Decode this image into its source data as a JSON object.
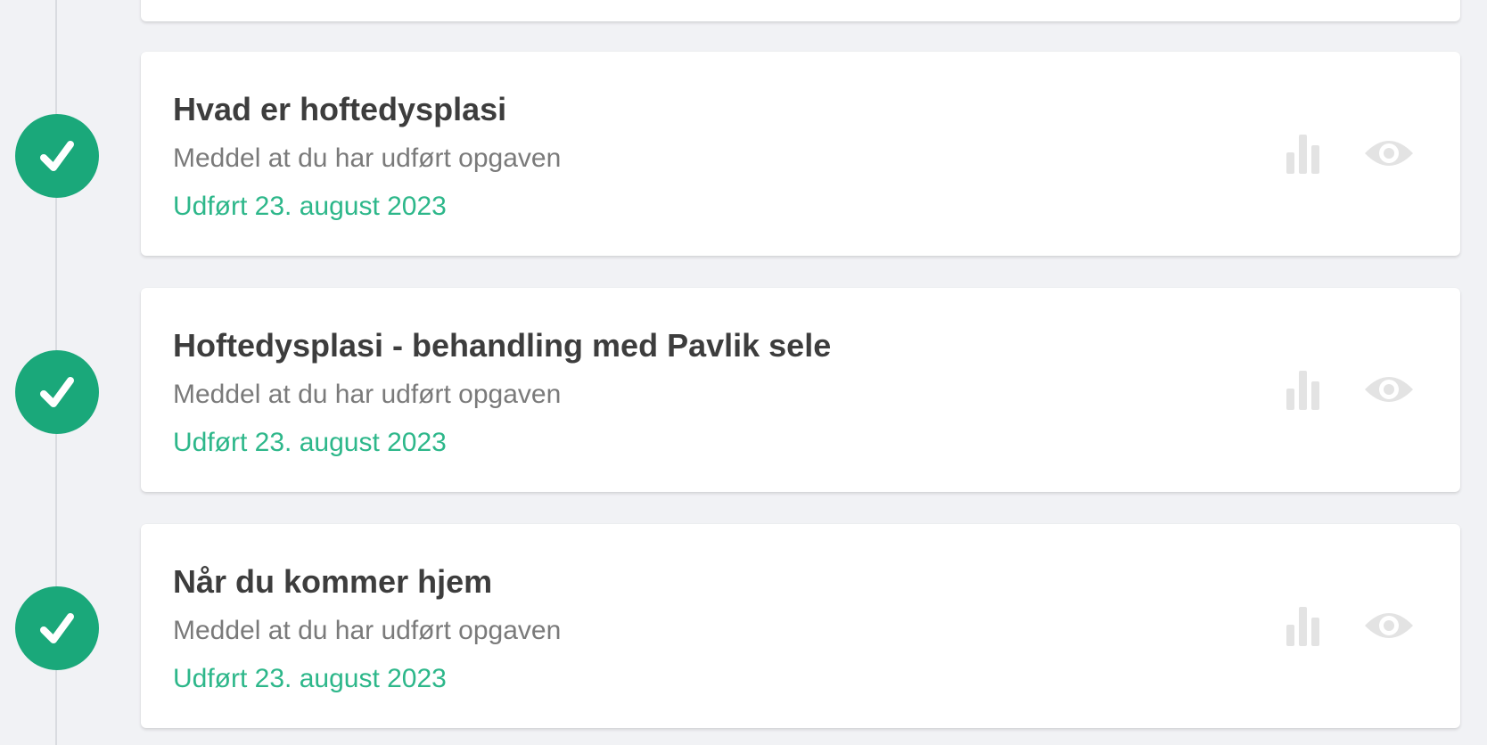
{
  "colors": {
    "background": "#f1f2f5",
    "card": "#ffffff",
    "title": "#3d3d3d",
    "subtitle": "#7a7a7a",
    "date": "#2db78a",
    "check_badge": "#1aa87a",
    "icon": "#e3e3e3"
  },
  "tasks": [
    {
      "title": "Hvad er hoftedysplasi",
      "subtitle": "Meddel at du har udført opgaven",
      "date": "Udført 23. august 2023",
      "status_icon": "check-icon",
      "actions": [
        "stats-icon",
        "eye-icon"
      ]
    },
    {
      "title": "Hoftedysplasi - behandling med Pavlik sele",
      "subtitle": "Meddel at du har udført opgaven",
      "date": "Udført 23. august 2023",
      "status_icon": "check-icon",
      "actions": [
        "stats-icon",
        "eye-icon"
      ]
    },
    {
      "title": "Når du kommer hjem",
      "subtitle": "Meddel at du har udført opgaven",
      "date": "Udført 23. august 2023",
      "status_icon": "check-icon",
      "actions": [
        "stats-icon",
        "eye-icon"
      ]
    }
  ]
}
